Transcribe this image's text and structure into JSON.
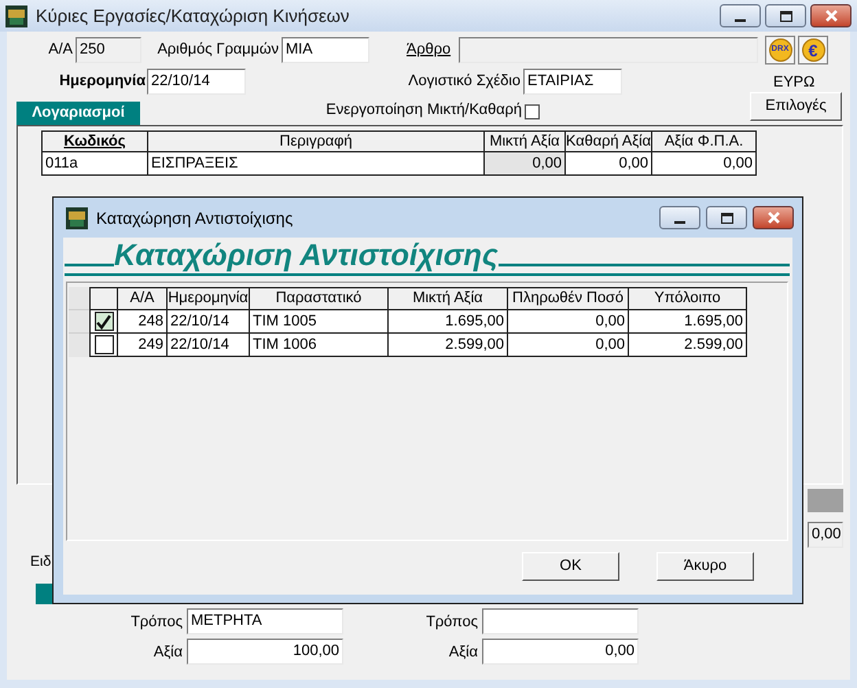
{
  "window": {
    "title": "Κύριες Εργασίες/Καταχώριση Κινήσεων"
  },
  "header": {
    "serial": {
      "label": "Α/Α",
      "value": "250",
      "readonly": true
    },
    "line_count": {
      "label": "Αριθμός Γραμμών",
      "value": "ΜΙΑ",
      "readonly": false
    },
    "article": {
      "label": "Άρθρο",
      "readonly": true
    },
    "drx_button": "DRX",
    "euro_button": "€",
    "date": {
      "label": "Ημερομηνία",
      "value": "22/10/14",
      "readonly": false
    },
    "chart_of_accounts": {
      "label": "Λογιστικό Σχέδιο",
      "value": "ΕΤΑΙΡΙΑΣ",
      "readonly": false
    },
    "currency": "ΕΥΡΩ",
    "accounts_tab": "Λογαριασμοί",
    "gross_net": {
      "label": "Ενεργοποίηση Μικτή/Καθαρή",
      "checked": false
    },
    "options_button": "Επιλογές"
  },
  "accounts_table": {
    "columns": [
      {
        "label": "Κωδικός",
        "sorted": true,
        "kind": "text",
        "readonly": false
      },
      {
        "label": "Περιγραφή",
        "sorted": false,
        "kind": "text",
        "readonly": false
      },
      {
        "label": "Μικτή Αξία",
        "sorted": false,
        "kind": "number",
        "readonly": true
      },
      {
        "label": "Καθαρή Αξία",
        "sorted": false,
        "kind": "number",
        "readonly": false
      },
      {
        "label": "Αξία Φ.Π.Α.",
        "sorted": false,
        "kind": "number",
        "readonly": false
      }
    ],
    "rows": [
      {
        "cells": [
          "011a",
          "ΕΙΣΠΡΑΞΕΙΣ",
          "0,00",
          "0,00",
          "0,00"
        ]
      }
    ]
  },
  "bottom": {
    "total": "0,00",
    "partial_label": "Ειδ",
    "payments": [
      {
        "method_label": "Τρόπος",
        "method": "ΜΕΤΡΗΤΑ",
        "amount_label": "Αξία",
        "amount": "100,00"
      },
      {
        "method_label": "Τρόπος",
        "amount_label": "Αξία",
        "amount": "0,00"
      }
    ]
  },
  "dialog": {
    "title": "Καταχώρηση Αντιστοίχισης",
    "heading": "Καταχώριση Αντιστοίχισης",
    "table": {
      "columns": [
        {
          "label": "Α/Α",
          "kind": "number"
        },
        {
          "label": "Ημερομηνία",
          "kind": "text"
        },
        {
          "label": "Παραστατικό",
          "kind": "text"
        },
        {
          "label": "Μικτή Αξία",
          "kind": "number"
        },
        {
          "label": "Πληρωθέν Ποσό",
          "kind": "number"
        },
        {
          "label": "Υπόλοιπο",
          "kind": "number"
        }
      ],
      "rows": [
        {
          "checked": true,
          "cells": [
            "248",
            "22/10/14",
            "ΤΙΜ 1005",
            "1.695,00",
            "0,00",
            "1.695,00"
          ]
        },
        {
          "checked": false,
          "cells": [
            "249",
            "22/10/14",
            "ΤΙΜ 1006",
            "2.599,00",
            "0,00",
            "2.599,00"
          ]
        }
      ]
    },
    "buttons": [
      "OK",
      "Άκυρο"
    ]
  }
}
